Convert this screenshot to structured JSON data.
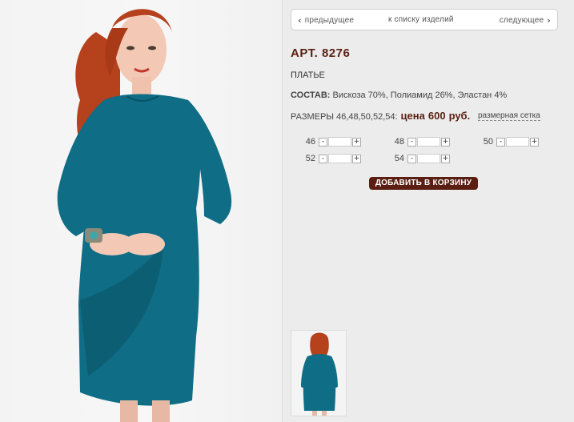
{
  "nav": {
    "prev_label": "предыдущее",
    "list_label": "к списку изделий",
    "next_label": "следующее"
  },
  "product": {
    "article": "АРТ. 8276",
    "type": "ПЛАТЬЕ",
    "composition_label": "СОСТАВ:",
    "composition_value": "Вискоза 70%, Полиамид 26%, Эластан 4%",
    "sizes_text": "РАЗМЕРЫ 46,48,50,52,54:",
    "price_word": "цена",
    "price_value": "600",
    "price_currency": "руб.",
    "size_chart_link": "размерная сетка",
    "dress_color": "#0f6d85"
  },
  "sizes": [
    "46",
    "48",
    "50",
    "52",
    "54"
  ],
  "qty_controls": {
    "minus": "-",
    "plus": "+"
  },
  "cart": {
    "add_label": "ДОБАВИТЬ В КОРЗИНУ"
  },
  "colors": {
    "accent": "#5a1f12",
    "panel_bg": "#ececec"
  }
}
